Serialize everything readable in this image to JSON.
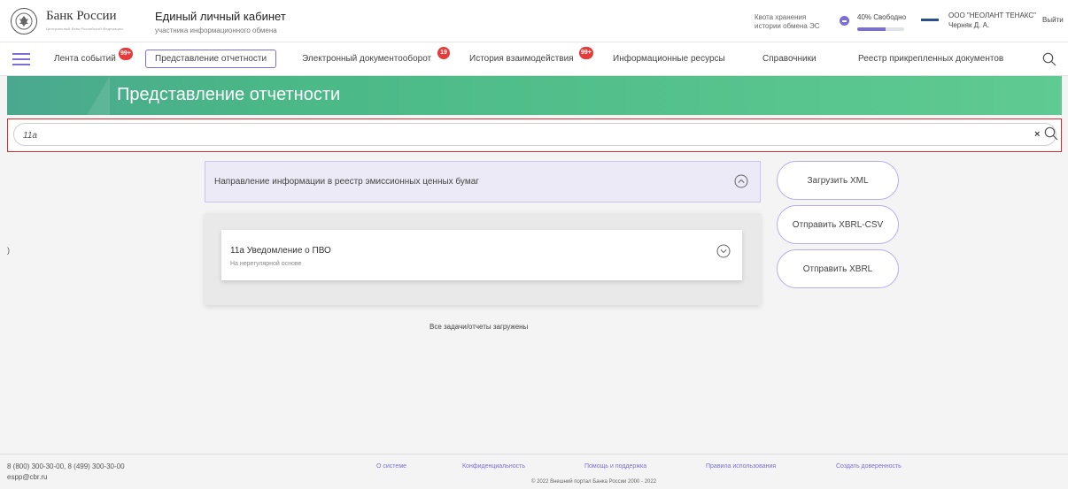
{
  "header": {
    "logo_text": "Банк России",
    "logo_subtext": "Центральный банк Российской Федерации",
    "title": "Единый личный кабинет",
    "subtitle": "участника информационного обмена",
    "quota_label": "Квота хранения истории обмена ЭС",
    "quota_free": "40% Свободно",
    "quota_used_fraction": 0.6,
    "org_name": "ООО \"НЕОЛАНТ ТЕНАКС\"",
    "user_name": "Черняк Д. А.",
    "logout": "Выйти"
  },
  "nav": {
    "items": [
      {
        "label": "Лента событий",
        "badge": "99+"
      },
      {
        "label": "Представление отчетности",
        "badge": ""
      },
      {
        "label": "Электронный документооборот",
        "badge": "19"
      },
      {
        "label": "История взаимодействия",
        "badge": "99+"
      },
      {
        "label": "Информационные ресурсы",
        "badge": ""
      },
      {
        "label": "Справочники",
        "badge": ""
      },
      {
        "label": "Реестр прикрепленных документов",
        "badge": ""
      }
    ],
    "search_icon": "search-icon",
    "menu_icon": "hamburger-icon"
  },
  "banner": {
    "title": "Представление отчетности"
  },
  "search": {
    "value": "11а",
    "placeholder": ""
  },
  "left_marker": ")",
  "section": {
    "title": "Направление информации в реестр эмиссионных ценных бумаг"
  },
  "reports": [
    {
      "title": "11а Уведомление о ПВО",
      "subtitle": "На нерегулярной основе"
    }
  ],
  "status": {
    "all_loaded": "Все задачи/отчеты загружены"
  },
  "actions": {
    "upload_xml": "Загрузить XML",
    "send_xbrl_csv": "Отправить XBRL-CSV",
    "send_xbrl": "Отправить XBRL"
  },
  "footer": {
    "phones": "8 (800) 300-30-00, 8 (499) 300-30-00",
    "email": "espp@cbr.ru",
    "links": [
      "О системе",
      "Конфиденциальность",
      "Помощь и поддержка",
      "Правила использования",
      "Создать доверенность"
    ],
    "copyright": "© 2022 Внешний портал Банка России 2000 - 2022"
  },
  "colors": {
    "accent": "#7b6ed6",
    "banner": "#4ab887",
    "badge": "#e63b3b",
    "search_border": "#d32f2f"
  }
}
